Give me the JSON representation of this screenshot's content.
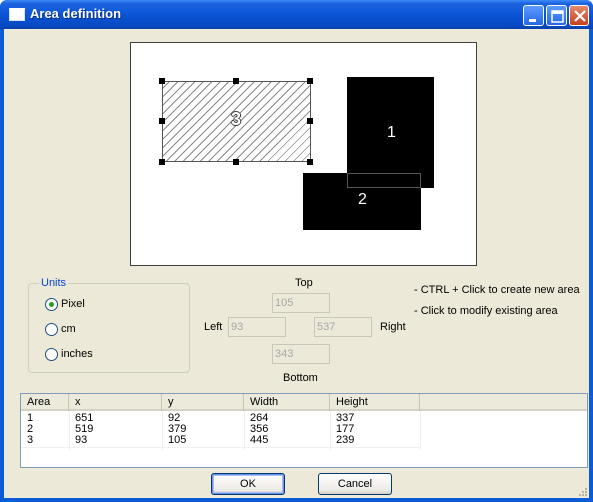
{
  "window": {
    "title": "Area definition"
  },
  "canvas": {
    "areas": [
      {
        "label": "1"
      },
      {
        "label": "2"
      },
      {
        "label": "3"
      }
    ]
  },
  "units": {
    "title": "Units",
    "options": [
      {
        "label": "Pixel",
        "checked": true
      },
      {
        "label": "cm",
        "checked": false
      },
      {
        "label": "inches",
        "checked": false
      }
    ]
  },
  "position": {
    "top_label": "Top",
    "left_label": "Left",
    "right_label": "Right",
    "bottom_label": "Bottom",
    "top_value": "105",
    "left_value": "93",
    "right_value": "537",
    "bottom_value": "343"
  },
  "hints": [
    "- CTRL + Click to create new area",
    "- Click to modify existing area"
  ],
  "table": {
    "columns": [
      "Area",
      "x",
      "y",
      "Width",
      "Height"
    ],
    "rows": [
      [
        "1",
        "651",
        "92",
        "264",
        "337"
      ],
      [
        "2",
        "519",
        "379",
        "356",
        "177"
      ],
      [
        "3",
        "93",
        "105",
        "445",
        "239"
      ]
    ]
  },
  "buttons": {
    "ok": "OK",
    "cancel": "Cancel"
  },
  "colors": {
    "titlebar": "#0a55d6",
    "dialog_background": "#ece9d8",
    "groupbox_title": "#0046d5"
  }
}
